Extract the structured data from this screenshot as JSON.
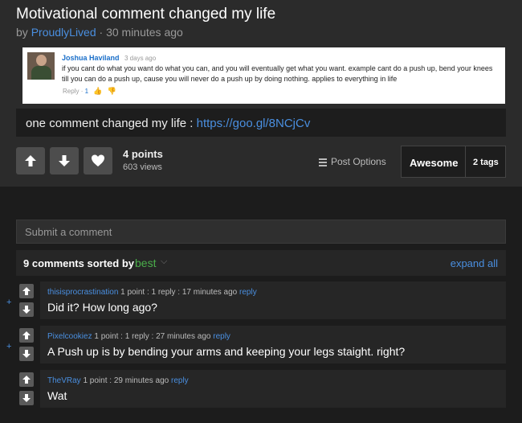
{
  "post": {
    "title": "Motivational comment changed my life",
    "by_prefix": "by",
    "author": "ProudlyLived",
    "time": "· 30 minutes ago",
    "points": "4 points",
    "views": "603 views",
    "post_options": "Post Options",
    "tag": "Awesome",
    "tag_count": "2 tags"
  },
  "screenshot": {
    "name": "Joshua Haviland",
    "time": "3 days ago",
    "text": "if you cant do what you want do what you can, and you will eventually get what you want. example cant do a push up, bend your knees till you can do a push up, cause you will never do a push up by doing nothing. applies to everything in life",
    "reply_label": "Reply",
    "dot": "·",
    "likes": "1"
  },
  "description": {
    "text": "one comment changed my life : ",
    "link": "https://goo.gl/8NCjCv"
  },
  "comments_section": {
    "submit_placeholder": "Submit a comment",
    "sort_text": "9 comments sorted by",
    "sort_value": "best",
    "expand": "expand all"
  },
  "comments": [
    {
      "user": "thisisprocrastination",
      "meta": " 1 point : 1 reply : 17 minutes ago ",
      "reply": "reply",
      "text": "Did it? How long ago?",
      "plus": "+"
    },
    {
      "user": "Pixelcookiez",
      "meta": " 1 point : 1 reply : 27 minutes ago ",
      "reply": "reply",
      "text": "A Push up is by bending your arms and keeping your legs staight. right?",
      "plus": "+"
    },
    {
      "user": "TheVRay",
      "meta": " 1 point : 29 minutes ago ",
      "reply": "reply",
      "text": "Wat"
    }
  ]
}
